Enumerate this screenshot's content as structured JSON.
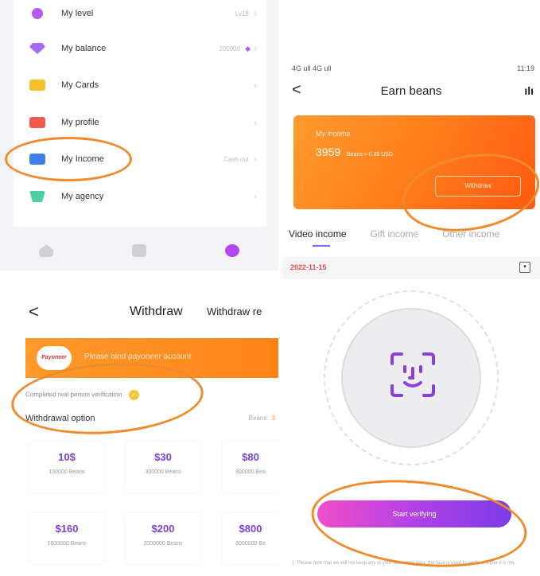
{
  "profile_menu": {
    "items": [
      {
        "label": "My level",
        "value": "Lv18",
        "icon": "level-icon",
        "color": "#b35cf0"
      },
      {
        "label": "My balance",
        "value": "200000",
        "icon": "diamond-icon",
        "color": "#a36cf2"
      },
      {
        "label": "My Cards",
        "value": "",
        "icon": "cards-icon",
        "color": "#f6c02a"
      },
      {
        "label": "My profile",
        "value": "",
        "icon": "profile-icon",
        "color": "#ef5a4a"
      },
      {
        "label": "My Income",
        "value": "Cash out",
        "icon": "income-icon",
        "color": "#3f7ff2"
      },
      {
        "label": "My agency",
        "value": "",
        "icon": "agency-icon",
        "color": "#4ccfa4"
      }
    ],
    "tabbar": [
      "home-icon",
      "live-icon",
      "me-icon"
    ]
  },
  "earn_beans": {
    "status_left": "4G ull 4G ull",
    "status_right": "11:19",
    "back": "<",
    "title": "Earn beans",
    "card": {
      "label": "My income",
      "amount": "3959",
      "conversion": "Beans ≈ 0.39 USD",
      "withdraw_label": "Withdraw"
    },
    "tabs": [
      "Video income",
      "Gift income",
      "Other income"
    ],
    "date": "2022-11-15"
  },
  "withdraw": {
    "back": "<",
    "title": "Withdraw",
    "title2": "Withdraw re",
    "logo_text": "Payoneer",
    "banner_text": "Please bind payoneer account",
    "verification_text": "Completed real person verification",
    "check": "✓",
    "option_label": "Withdrawal option",
    "beans_label": "Beans:",
    "beans_value": "3",
    "options": [
      {
        "price": "10$",
        "beans": "100000 Beans"
      },
      {
        "price": "$30",
        "beans": "300000 Beans"
      },
      {
        "price": "$80",
        "beans": "800000 Bea"
      },
      {
        "price": "$160",
        "beans": "1600000 Beans"
      },
      {
        "price": "$200",
        "beans": "2000000 Beans"
      },
      {
        "price": "$800",
        "beans": "8000000 Be"
      }
    ]
  },
  "verify": {
    "button_label": "Start verifying",
    "note": "1. Please note that we will not keep any of your face video data, the face is used to verify whether it is me."
  },
  "colors": {
    "accent": "#8a5cf6",
    "orange": "#ff8418",
    "annotation": "#f08a2b"
  }
}
